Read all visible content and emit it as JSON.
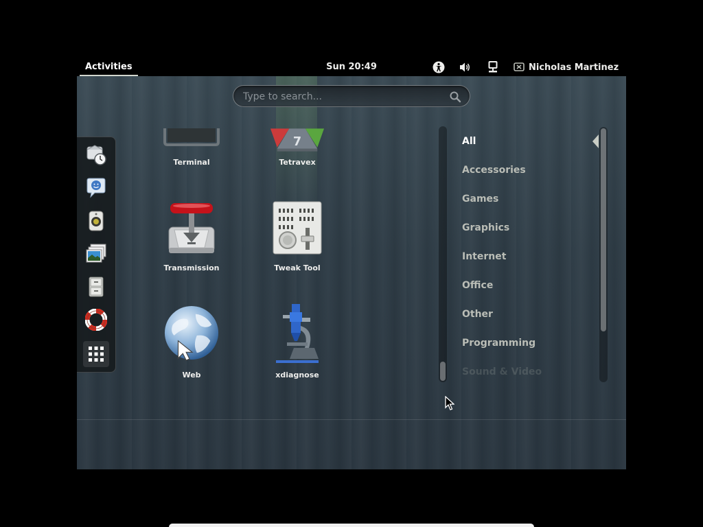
{
  "topbar": {
    "activities_label": "Activities",
    "clock": "Sun 20:49",
    "user_name": "Nicholas Martinez",
    "icons": [
      "accessibility-icon",
      "volume-icon",
      "network-wired-icon",
      "user-status-icon"
    ]
  },
  "search": {
    "placeholder": "Type to search..."
  },
  "dash": {
    "items": [
      {
        "name": "backup-app",
        "icon": "clock-disk-icon"
      },
      {
        "name": "empathy-chat",
        "icon": "chat-bubble-icon"
      },
      {
        "name": "rhythmbox",
        "icon": "speaker-icon"
      },
      {
        "name": "shotwell",
        "icon": "photos-icon"
      },
      {
        "name": "file-manager",
        "icon": "file-cabinet-icon"
      },
      {
        "name": "help",
        "icon": "lifebuoy-icon"
      },
      {
        "name": "show-applications",
        "icon": "app-grid-icon"
      }
    ]
  },
  "apps": [
    {
      "label": "Terminal"
    },
    {
      "label": "Tetravex"
    },
    {
      "label": "Transmission"
    },
    {
      "label": "Tweak Tool"
    },
    {
      "label": "Web"
    },
    {
      "label": "xdiagnose"
    }
  ],
  "tetravex_digit": "7",
  "categories": [
    "All",
    "Accessories",
    "Games",
    "Graphics",
    "Internet",
    "Office",
    "Other",
    "Programming",
    "Sound & Video"
  ],
  "active_category": "All",
  "app_scroll_fraction": 1.0,
  "category_scroll_fraction": 0.0,
  "colors": {
    "panel_bg": "#000000",
    "overview_bg": "#34434d",
    "text": "#eeeeec",
    "category_text": "#babdb6"
  }
}
